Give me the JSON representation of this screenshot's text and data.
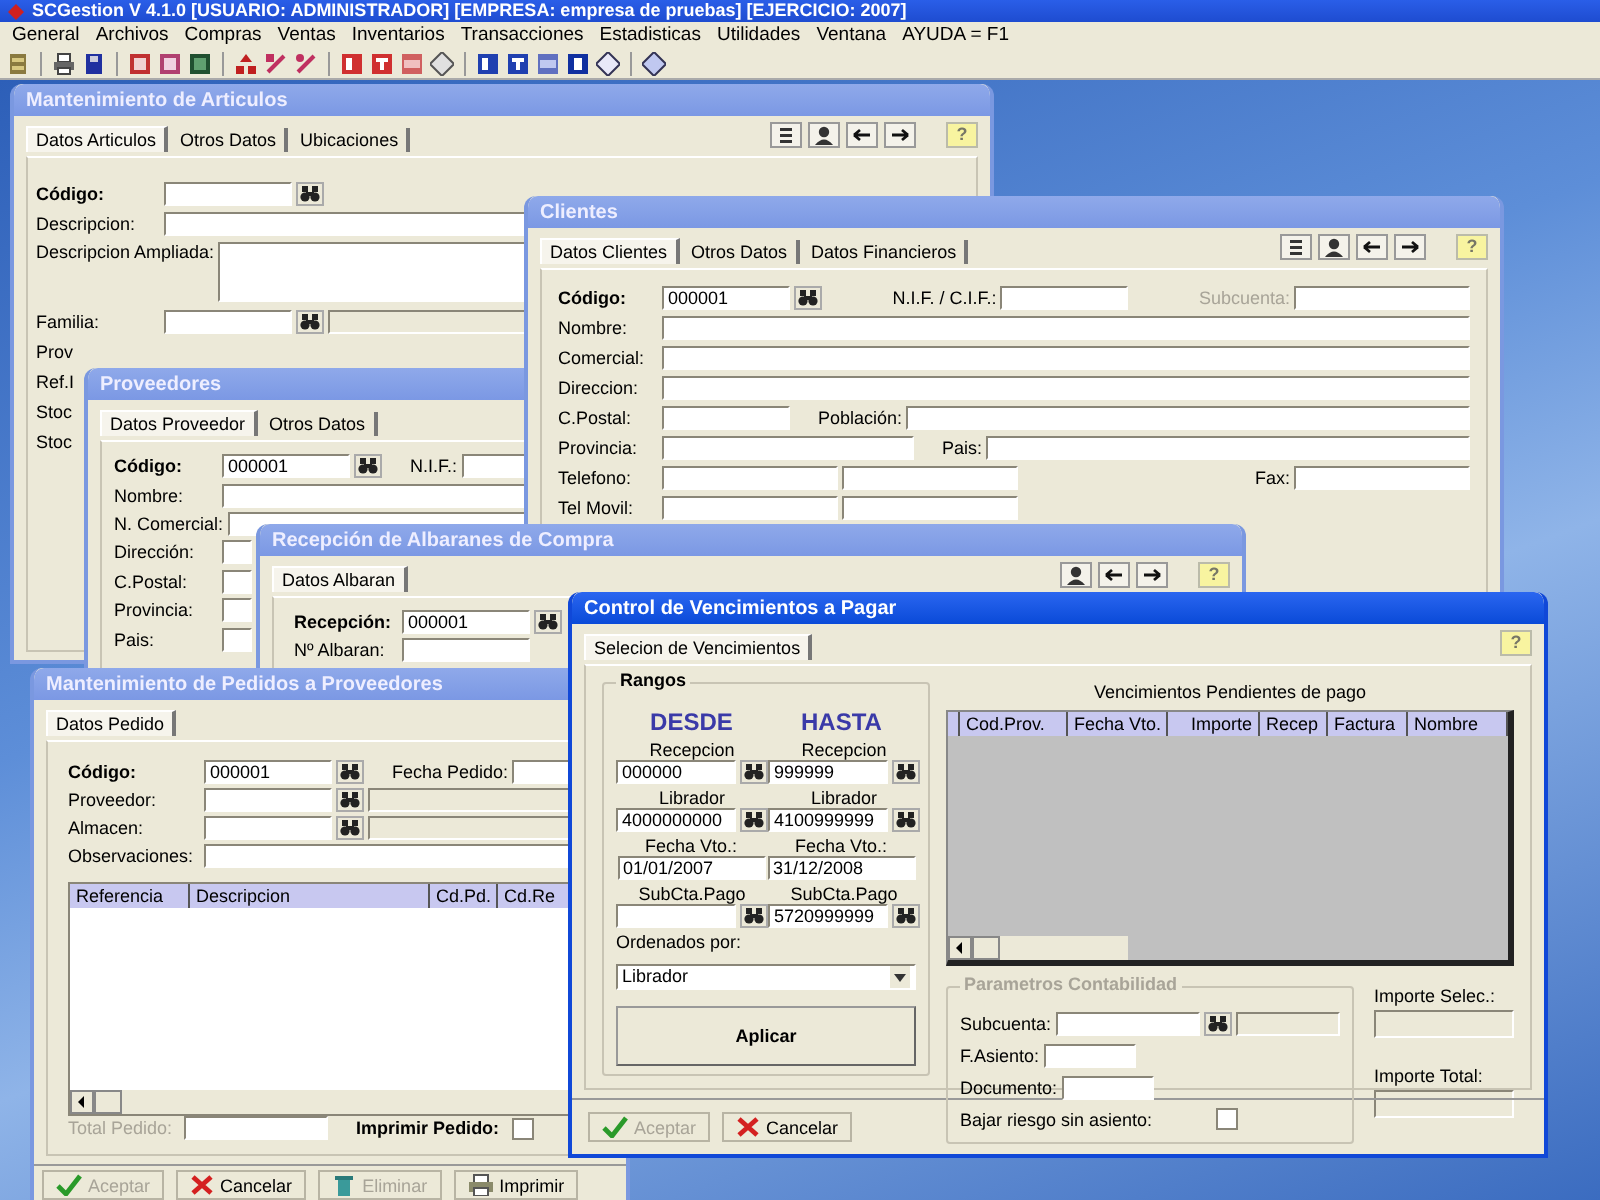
{
  "app_title": "SCGestion V 4.1.0  [USUARIO: ADMINISTRADOR]  [EMPRESA: empresa de pruebas]  [EJERCICIO: 2007]",
  "menu": [
    "General",
    "Archivos",
    "Compras",
    "Ventas",
    "Inventarios",
    "Transacciones",
    "Estadisticas",
    "Utilidades",
    "Ventana",
    "AYUDA = F1"
  ],
  "windows": [
    {
      "title": "Mantenimiento de Articulos",
      "kind": "form",
      "active": false,
      "help": "?",
      "tabs": [
        {
          "label": "Datos Articulos",
          "selected": true
        },
        {
          "label": "Otros Datos",
          "selected": false
        },
        {
          "label": "Ubicaciones",
          "selected": false
        }
      ],
      "rows": [
        [
          {
            "kind": "key-label",
            "text": "Código:"
          },
          {
            "kind": "field"
          },
          {
            "kind": "lookup"
          }
        ],
        [
          {
            "kind": "label",
            "text": "Descripcion:"
          },
          {
            "kind": "wide-field"
          }
        ],
        [
          {
            "kind": "label",
            "text": "Descripcion Ampliada:"
          },
          {
            "kind": "textarea"
          }
        ],
        [
          {
            "kind": "label",
            "text": "Familia:"
          },
          {
            "kind": "field"
          },
          {
            "kind": "lookup"
          },
          {
            "kind": "readonly-field"
          }
        ],
        [
          {
            "kind": "label",
            "text": "Prov"
          }
        ],
        [
          {
            "kind": "label",
            "text": "Ref.I"
          }
        ],
        [
          {
            "kind": "label",
            "text": "Stoc"
          }
        ],
        [
          {
            "kind": "label",
            "text": "Stoc"
          }
        ]
      ]
    },
    {
      "title": "Proveedores",
      "kind": "form",
      "active": false,
      "tabs": [
        {
          "label": "Datos Proveedor",
          "selected": true
        },
        {
          "label": "Otros Datos",
          "selected": false
        }
      ],
      "rows": [
        [
          {
            "kind": "key-label",
            "text": "Código:"
          },
          {
            "kind": "field",
            "value": "000001"
          },
          {
            "kind": "lookup"
          },
          {
            "kind": "label",
            "text": "N.I.F.:"
          },
          {
            "kind": "wide-field"
          }
        ],
        [
          {
            "kind": "label",
            "text": "Nombre:"
          },
          {
            "kind": "wide-field"
          }
        ],
        [
          {
            "kind": "label",
            "text": "N. Comercial:"
          },
          {
            "kind": "wide-field"
          }
        ],
        [
          {
            "kind": "label",
            "text": "Dirección:"
          },
          {
            "kind": "stub-field"
          }
        ],
        [
          {
            "kind": "label",
            "text": "C.Postal:"
          },
          {
            "kind": "stub-field"
          }
        ],
        [
          {
            "kind": "label",
            "text": "Provincia:"
          },
          {
            "kind": "stub-field"
          }
        ],
        [
          {
            "kind": "label",
            "text": "Pais:"
          },
          {
            "kind": "stub-field"
          }
        ]
      ]
    },
    {
      "title": "Clientes",
      "kind": "form",
      "active": false,
      "help": "?",
      "tabs": [
        {
          "label": "Datos Clientes",
          "selected": true
        },
        {
          "label": "Otros Datos",
          "selected": false
        },
        {
          "label": "Datos Financieros",
          "selected": false
        }
      ],
      "rows": [
        {
          "items": [
            {
              "kind": "key-label",
              "text": "Código:"
            },
            {
              "kind": "field",
              "value": "000001"
            },
            {
              "kind": "lookup"
            },
            {
              "kind": "label",
              "text": "N.I.F. / C.I.F.:"
            },
            {
              "kind": "field"
            },
            {
              "kind": "label",
              "text": "Subcuenta:",
              "disabled": true
            },
            {
              "kind": "mid-field"
            }
          ]
        },
        {
          "items": [
            {
              "kind": "label",
              "text": "Nombre:"
            },
            {
              "kind": "wide-field"
            }
          ]
        },
        {
          "items": [
            {
              "kind": "label",
              "text": "Comercial:"
            },
            {
              "kind": "wide-field"
            }
          ]
        },
        {
          "items": [
            {
              "kind": "label",
              "text": "Direccion:"
            },
            {
              "kind": "wide-field"
            }
          ]
        },
        {
          "items": [
            {
              "kind": "label",
              "text": "C.Postal:"
            },
            {
              "kind": "field"
            },
            {
              "kind": "label",
              "text": "Población:"
            },
            {
              "kind": "wide-field"
            }
          ]
        },
        {
          "items": [
            {
              "kind": "label",
              "text": "Provincia:"
            },
            {
              "kind": "big-field"
            },
            {
              "kind": "label",
              "text": "Pais:"
            },
            {
              "kind": "wide-field"
            }
          ]
        },
        {
          "items": [
            {
              "kind": "label",
              "text": "Telefono:"
            },
            {
              "kind": "mid-field"
            },
            {
              "kind": "mid-field"
            },
            {
              "kind": "label",
              "text": "Fax:"
            },
            {
              "kind": "mid-field"
            }
          ]
        },
        {
          "items": [
            {
              "kind": "label",
              "text": "Tel Movil:"
            },
            {
              "kind": "mid-field"
            },
            {
              "kind": "mid-field"
            }
          ]
        }
      ]
    },
    {
      "title": "Recepción de Albaranes de Compra",
      "kind": "form",
      "active": false,
      "help": "?",
      "tabs": [
        {
          "label": "Datos Albaran",
          "selected": true
        }
      ],
      "rows": [
        [
          {
            "kind": "key-label",
            "text": "Recepción:"
          },
          {
            "kind": "field",
            "value": "000001"
          },
          {
            "kind": "lookup"
          }
        ],
        [
          {
            "kind": "label",
            "text": "Nº Albaran:"
          },
          {
            "kind": "field"
          }
        ]
      ]
    },
    {
      "title": "Mantenimiento de Pedidos a Proveedores",
      "kind": "form",
      "active": false,
      "tabs": [
        {
          "label": "Datos Pedido",
          "selected": true
        }
      ],
      "rows": [
        [
          {
            "kind": "key-label",
            "text": "Código:"
          },
          {
            "kind": "field",
            "value": "000001"
          },
          {
            "kind": "lookup"
          },
          {
            "kind": "label",
            "text": "Fecha Pedido:"
          },
          {
            "kind": "field"
          }
        ],
        [
          {
            "kind": "label",
            "text": "Proveedor:"
          },
          {
            "kind": "field"
          },
          {
            "kind": "lookup"
          },
          {
            "kind": "readonly-field"
          }
        ],
        [
          {
            "kind": "label",
            "text": "Almacen:"
          },
          {
            "kind": "field"
          },
          {
            "kind": "lookup"
          },
          {
            "kind": "readonly-field"
          }
        ],
        [
          {
            "kind": "label",
            "text": "Observaciones:"
          },
          {
            "kind": "wide-field"
          }
        ]
      ],
      "table": {
        "columns": [
          "Referencia",
          "Descripcion",
          "Cd.Pd.",
          "Cd.Re"
        ]
      },
      "footer": {
        "total_label": "Total Pedido:",
        "total_disabled": true,
        "print_label": "Imprimir Pedido:",
        "print_checked": false
      },
      "buttons": [
        {
          "label": "Aceptar",
          "kind": "accept",
          "disabled": true
        },
        {
          "label": "Cancelar",
          "kind": "cancel",
          "disabled": false
        },
        {
          "label": "Eliminar",
          "kind": "delete",
          "disabled": true
        },
        {
          "label": "Imprimir",
          "kind": "print",
          "disabled": false
        }
      ]
    },
    {
      "title": "Control de Vencimientos a Pagar",
      "kind": "due-payments",
      "active": true,
      "help": "?",
      "tabs": [
        {
          "label": "Selecion de Vencimientos",
          "selected": true
        }
      ],
      "ranges": {
        "title": "Rangos",
        "from_heading": "DESDE",
        "to_heading": "HASTA",
        "pairs": [
          {
            "from_label": "Recepcion",
            "from": "000000",
            "to_label": "Recepcion",
            "to": "999999",
            "lookup": true
          },
          {
            "from_label": "Librador",
            "from": "4000000000",
            "to_label": "Librador",
            "to": "4100999999",
            "lookup": true
          },
          {
            "from_label": "Fecha Vto.:",
            "from": "01/01/2007",
            "to_label": "Fecha Vto.:",
            "to": "31/12/2008",
            "lookup": false
          },
          {
            "from_label": "SubCta.Pago",
            "to_label": "SubCta.Pago",
            "to": "5720999999",
            "lookup": true
          }
        ]
      },
      "order_by": {
        "label": "Ordenados por:",
        "value": "Librador"
      },
      "apply_button": "Aplicar",
      "grid": {
        "title": "Vencimientos Pendientes de pago",
        "columns": [
          "Cod.Prov.",
          "Fecha Vto.",
          "Importe",
          "Recep",
          "Factura",
          "Nombre"
        ]
      },
      "accounting": {
        "legend": "Parametros Contabilidad",
        "disabled": true,
        "fields": [
          {
            "label": "Subcuenta:",
            "kind": "lookup-field"
          },
          {
            "label": "F.Asiento:",
            "kind": "field"
          },
          {
            "label": "Documento:",
            "kind": "field"
          },
          {
            "label": "Bajar riesgo sin asiento:",
            "kind": "checkbox",
            "checked": false
          }
        ]
      },
      "totals": [
        {
          "label": "Importe Selec.:"
        },
        {
          "label": "Importe Total:"
        }
      ],
      "buttons": [
        {
          "label": "Aceptar",
          "kind": "accept",
          "disabled": true
        },
        {
          "label": "Cancelar",
          "kind": "cancel",
          "disabled": false
        }
      ]
    }
  ]
}
